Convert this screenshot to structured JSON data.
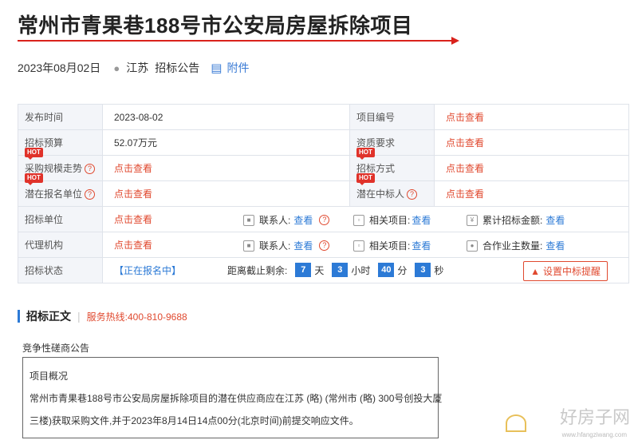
{
  "header": {
    "title": "常州市青果巷188号市公安局房屋拆除项目",
    "date": "2023年08月02日",
    "location": "江苏",
    "notice_type": "招标公告",
    "attachment": "附件",
    "accent_color": "#d9221c"
  },
  "info": {
    "hot_badge": "HOT",
    "publish_label": "发布时间",
    "publish_value": "2023-08-02",
    "project_no_label": "项目编号",
    "project_no_value": "点击查看",
    "budget_label": "招标预算",
    "budget_value": "52.07万元",
    "qualification_label": "资质要求",
    "qualification_value": "点击查看",
    "scale_label": "采购规模走势",
    "scale_value": "点击查看",
    "method_label": "招标方式",
    "method_value": "点击查看",
    "bidders_label": "潜在报名单位",
    "bidders_value": "点击查看",
    "winner_label": "潜在中标人",
    "winner_value": "点击查看",
    "unit_label": "招标单位",
    "unit_value": "点击查看",
    "contact_label": "联系人:",
    "contact_value": "查看",
    "related_label": "相关项目:",
    "related_value": "查看",
    "total_label": "累计招标金额:",
    "total_value": "查看",
    "agent_label": "代理机构",
    "agent_value": "点击查看",
    "agent_contact_label": "联系人:",
    "agent_contact_value": "查看",
    "agent_related_label": "相关项目:",
    "agent_related_value": "查看",
    "coop_label": "合作业主数量:",
    "coop_value": "查看",
    "status_label": "招标状态",
    "status_value": "【正在报名中】",
    "countdown_label": "距离截止剩余:",
    "days": "7",
    "days_unit": "天",
    "hours": "3",
    "hours_unit": "小时",
    "minutes": "40",
    "minutes_unit": "分",
    "seconds": "3",
    "seconds_unit": "秒",
    "remind_button": "设置中标提醒"
  },
  "body": {
    "section_title": "招标正文",
    "hotline": "服务热线:400-810-9688",
    "subhead": "竞争性磋商公告",
    "overview_title": "项目概况",
    "overview_line1": "常州市青果巷188号市公安局房屋拆除项目的潜在供应商应在江苏 (略) (常州市 (略) 300号创投大厦",
    "overview_line2": "三楼)获取采购文件,并于2023年8月14日14点00分(北京时间)前提交响应文件。"
  },
  "watermark": {
    "text": "好房子网",
    "url": "www.hfangziwang.com"
  }
}
